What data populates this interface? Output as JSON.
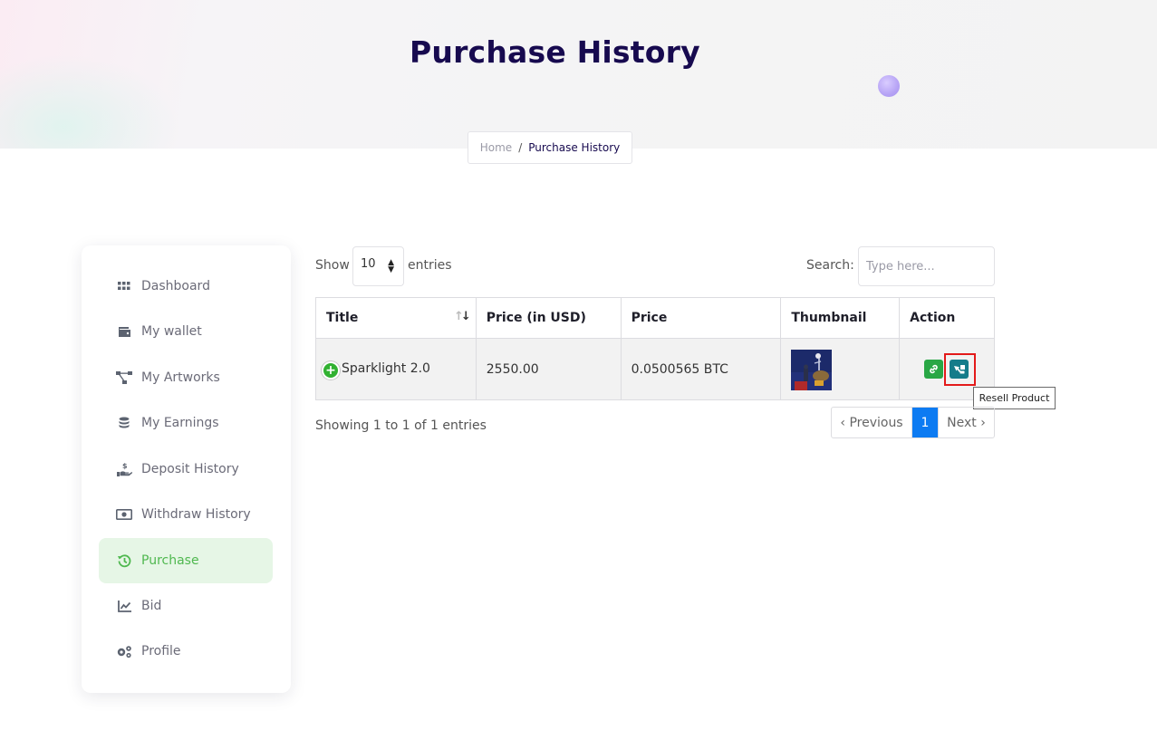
{
  "page": {
    "title": "Purchase History"
  },
  "breadcrumb": {
    "home": "Home",
    "separator": "/",
    "current": "Purchase History"
  },
  "sidebar": {
    "items": [
      {
        "label": "Dashboard",
        "icon": "grid-icon",
        "active": false
      },
      {
        "label": "My wallet",
        "icon": "wallet-icon",
        "active": false
      },
      {
        "label": "My Artworks",
        "icon": "network-icon",
        "active": false
      },
      {
        "label": "My Earnings",
        "icon": "coins-icon",
        "active": false
      },
      {
        "label": "Deposit History",
        "icon": "hand-dollar-icon",
        "active": false
      },
      {
        "label": "Withdraw History",
        "icon": "money-bill-icon",
        "active": false
      },
      {
        "label": "Purchase",
        "icon": "history-icon",
        "active": true
      },
      {
        "label": "Bid",
        "icon": "chart-line-icon",
        "active": false
      },
      {
        "label": "Profile",
        "icon": "cogs-icon",
        "active": false
      }
    ]
  },
  "table_controls": {
    "show_label": "Show",
    "page_length": "10",
    "entries_label": "entries",
    "search_label": "Search:",
    "search_placeholder": "Type here..."
  },
  "table": {
    "columns": [
      "Title",
      "Price (in USD)",
      "Price",
      "Thumbnail",
      "Action"
    ],
    "rows": [
      {
        "title": "Sparklight 2.0",
        "price_usd": "2550.00",
        "price_crypto": "0.0500565 BTC",
        "thumbnail": "artwork-thumbnail"
      }
    ]
  },
  "tooltip": {
    "text": "Resell Product"
  },
  "footer": {
    "info": "Showing 1 to 1 of 1 entries",
    "prev_label": "‹ Previous",
    "current_page": "1",
    "next_label": "Next ›"
  },
  "colors": {
    "title": "#170a4f",
    "active_nav": "#4fb84f",
    "active_nav_bg": "#e6f6e6",
    "link_button": "#29a745",
    "resell_button": "#157c8a",
    "page_active": "#0d7bf2",
    "highlight": "#e31a1a"
  }
}
